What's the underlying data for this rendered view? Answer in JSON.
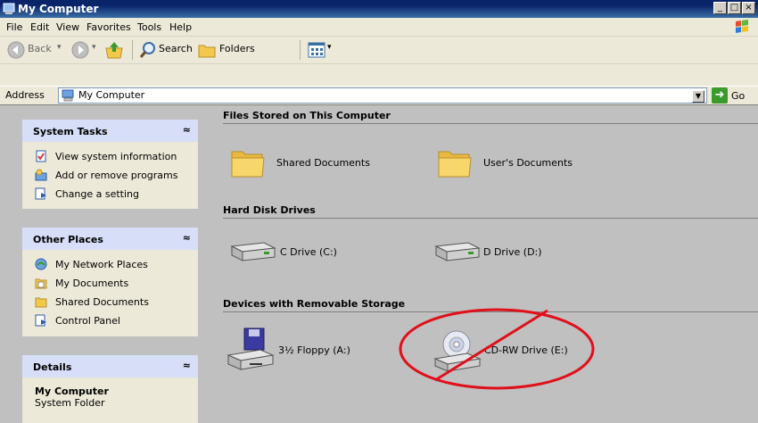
{
  "window": {
    "title": "My Computer"
  },
  "menu": [
    "File",
    "Edit",
    "View",
    "Favorites",
    "Tools",
    "Help"
  ],
  "toolbar": {
    "back": "Back",
    "search": "Search",
    "folders": "Folders"
  },
  "address": {
    "label": "Address",
    "value": "My Computer",
    "go": "Go"
  },
  "panels": {
    "system_tasks": {
      "title": "System Tasks",
      "items": [
        "View system information",
        "Add or remove programs",
        "Change a setting"
      ]
    },
    "other_places": {
      "title": "Other Places",
      "items": [
        "My Network Places",
        "My Documents",
        "Shared Documents",
        "Control Panel"
      ]
    },
    "details": {
      "title": "Details",
      "name": "My Computer",
      "type": "System Folder"
    }
  },
  "sections": {
    "files": {
      "title": "Files Stored on This Computer",
      "items": [
        "Shared Documents",
        "User's Documents"
      ]
    },
    "hdd": {
      "title": "Hard Disk Drives",
      "items": [
        "C Drive (C:)",
        "D Drive (D:)"
      ]
    },
    "removable": {
      "title": "Devices with Removable Storage",
      "items": [
        "3½ Floppy (A:)",
        "CD-RW Drive (E:)"
      ]
    }
  },
  "annotation": {
    "color": "#E0101A"
  }
}
